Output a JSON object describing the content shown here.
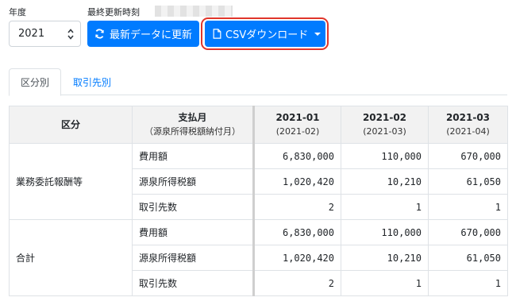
{
  "header": {
    "year_label": "年度",
    "last_updated_label": "最終更新時刻",
    "year_value": "2021",
    "refresh_button": "最新データに更新",
    "csv_button": "CSVダウンロード"
  },
  "tabs": [
    {
      "label": "区分別",
      "active": true
    },
    {
      "label": "取引先別",
      "active": false
    }
  ],
  "table": {
    "col_category": "区分",
    "col_payment_month": "支払月",
    "col_payment_month_sub": "（源泉所得税額納付月）",
    "months": [
      {
        "label": "2021-01",
        "sub": "(2021-02)"
      },
      {
        "label": "2021-02",
        "sub": "(2021-03)"
      },
      {
        "label": "2021-03",
        "sub": "(2021-04)"
      }
    ],
    "groups": [
      {
        "name": "業務委託報酬等",
        "rows": [
          {
            "item": "費用額",
            "values": [
              "6,830,000",
              "110,000",
              "670,000"
            ]
          },
          {
            "item": "源泉所得税額",
            "values": [
              "1,020,420",
              "10,210",
              "61,050"
            ]
          },
          {
            "item": "取引先数",
            "values": [
              "2",
              "1",
              "1"
            ]
          }
        ]
      },
      {
        "name": "合計",
        "rows": [
          {
            "item": "費用額",
            "values": [
              "6,830,000",
              "110,000",
              "670,000"
            ]
          },
          {
            "item": "源泉所得税額",
            "values": [
              "1,020,420",
              "10,210",
              "61,050"
            ]
          },
          {
            "item": "取引先数",
            "values": [
              "2",
              "1",
              "1"
            ]
          }
        ]
      }
    ]
  },
  "colors": {
    "primary": "#007bff",
    "highlight_ring": "#e0352b",
    "header_bg": "#f2f2f2"
  }
}
